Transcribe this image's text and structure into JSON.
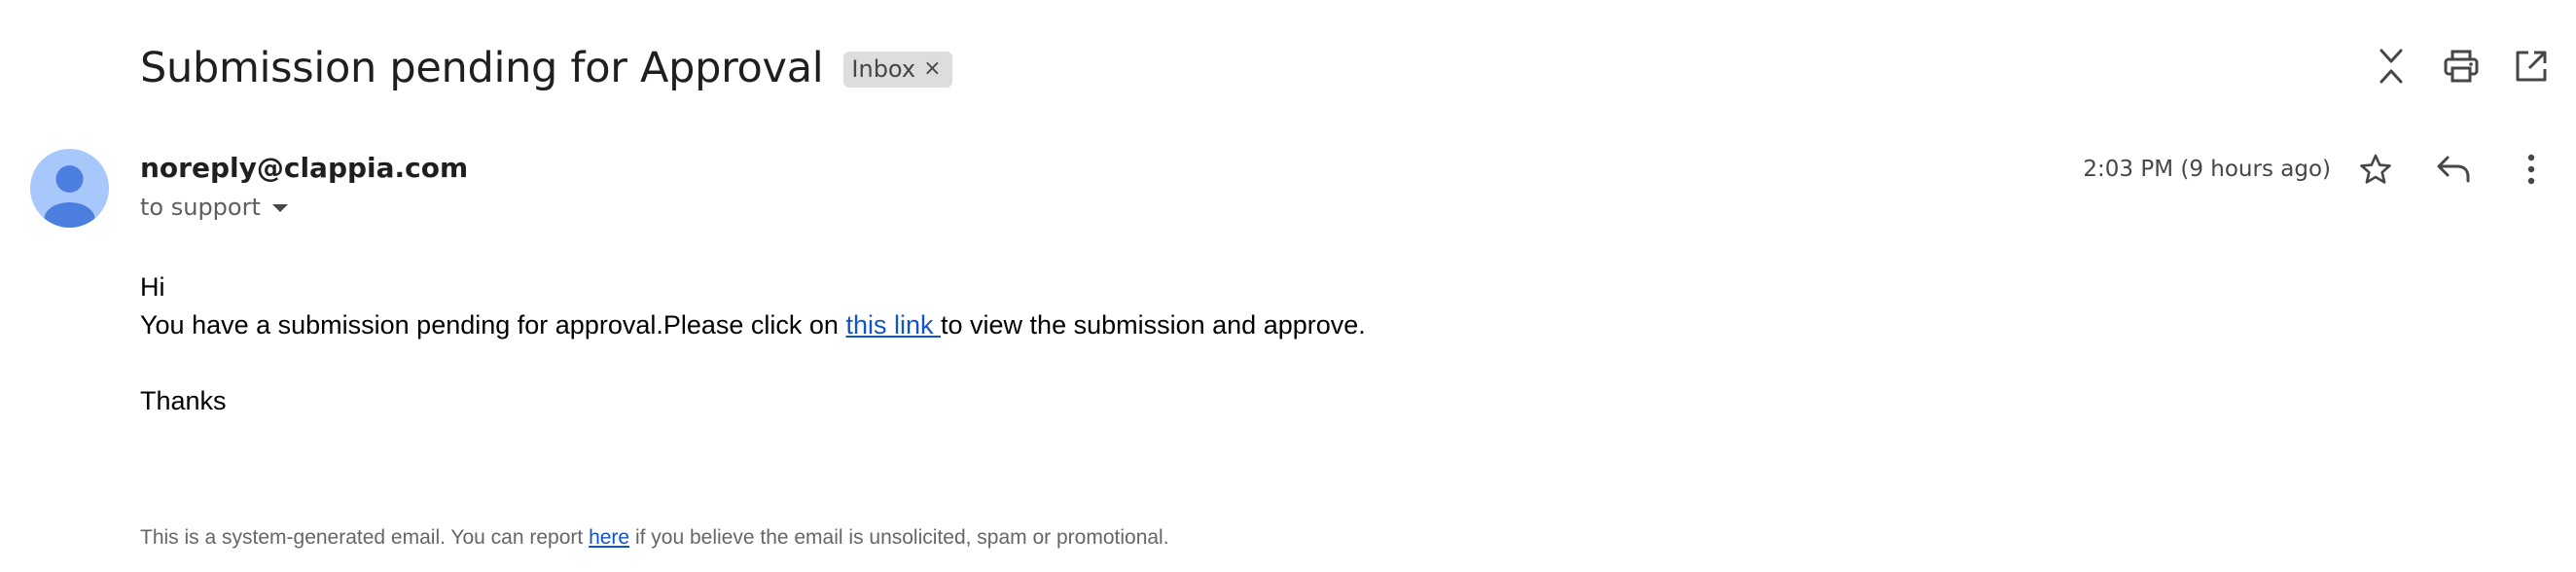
{
  "email": {
    "subject": "Submission pending for Approval",
    "label_chip": {
      "label": "Inbox",
      "remove_glyph": "×"
    },
    "sender": "noreply@clappia.com",
    "recipient_line": "to support",
    "timestamp": "2:03 PM (9 hours ago)",
    "body": {
      "greeting": "Hi",
      "line1_before_link": "You have a submission pending for approval.Please click on ",
      "link_text": "this link ",
      "line1_after_link": "to view the submission and approve.",
      "closing": "Thanks"
    },
    "footer": {
      "before_link": "This is a system-generated email. You can report ",
      "link_text": "here",
      "after_link": " if you believe the email is unsolicited, spam or promotional."
    }
  },
  "icons": {
    "top_actions": [
      "collapse-all-icon",
      "print-icon",
      "open-in-new-window-icon"
    ],
    "message_actions": [
      "star-icon",
      "reply-icon",
      "more-vert-icon"
    ],
    "avatar": "default-avatar-icon"
  },
  "colors": {
    "avatar_bg": "#a8c7fa",
    "avatar_figure": "#4c7ee0",
    "link": "#1155cc",
    "chip_bg": "#dddddd"
  }
}
